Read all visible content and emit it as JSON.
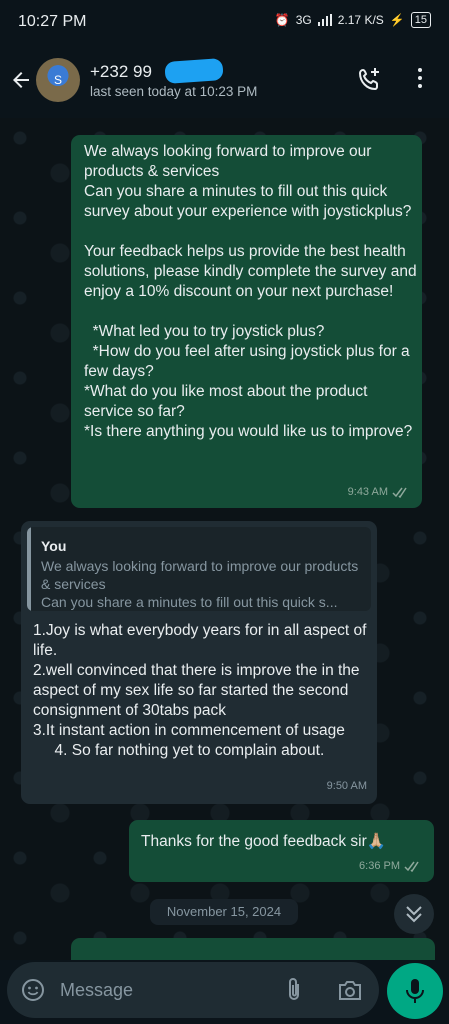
{
  "status_bar": {
    "time": "10:27 PM",
    "network": "3G",
    "speed": "2.17",
    "speed_unit": "K/S",
    "battery": "15"
  },
  "header": {
    "contact_name": "+232 99",
    "last_seen": "last seen today at 10:23 PM",
    "avatar_text": "S"
  },
  "messages": [
    {
      "direction": "outgoing",
      "text": "We always looking forward to improve our products & services\nCan you share a minutes to fill out this quick survey about your experience with joystickplus?\n\nYour feedback helps us provide the best health solutions, please kindly complete the survey and enjoy a 10% discount on your next purchase!\n\n  *What led you to try joystick plus?\n  *How do you feel after using joystick plus for a few days?\n*What do you like most about the product service so far?\n*Is there anything you would like us to improve?",
      "time": "9:43 AM"
    },
    {
      "direction": "incoming",
      "quote_author": "You",
      "quote_text": "We always looking forward to improve our products & services\nCan you share a minutes to fill out this quick s...",
      "text": "1.Joy is what everybody years for in all aspect of life.\n2.well convinced that there is improve the in the aspect of my sex life so far started the second consignment of 30tabs pack\n3.It instant action in commencement of usage\n     4. So far nothing yet to complain about.",
      "time": "9:50 AM"
    },
    {
      "direction": "outgoing",
      "text": "Thanks for the good feedback sir🙏🏼",
      "time": "6:36 PM"
    }
  ],
  "date_separator": "November 15, 2024",
  "composer": {
    "placeholder": "Message"
  },
  "colors": {
    "outgoing_bubble": "#144d37",
    "incoming_bubble": "#202c33",
    "accent": "#00a884",
    "background": "#0b141a"
  }
}
